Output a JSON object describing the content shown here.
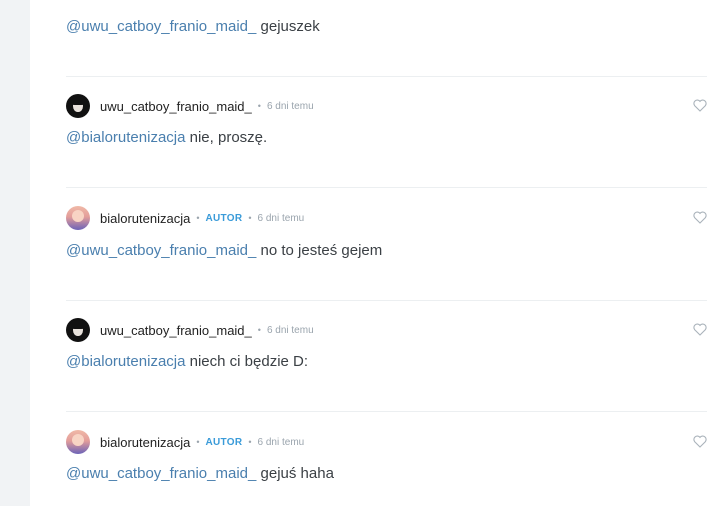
{
  "comments": [
    {
      "mention": "@uwu_catboy_franio_maid_",
      "text": " gejuszek"
    },
    {
      "username": "uwu_catboy_franio_maid_",
      "time": "6 dni temu",
      "mention": "@bialorutenizacja",
      "text": " nie, proszę.",
      "avatar": "dark"
    },
    {
      "username": "bialorutenizacja",
      "badge": "AUTOR",
      "time": "6 dni temu",
      "mention": "@uwu_catboy_franio_maid_",
      "text": " no to jesteś gejem",
      "avatar": "pink"
    },
    {
      "username": "uwu_catboy_franio_maid_",
      "time": "6 dni temu",
      "mention": "@bialorutenizacja",
      "text": " niech ci będzie D:",
      "avatar": "dark"
    },
    {
      "username": "bialorutenizacja",
      "badge": "AUTOR",
      "time": "6 dni temu",
      "mention": "@uwu_catboy_franio_maid_",
      "text": " gejuś haha",
      "avatar": "pink"
    }
  ],
  "colors": {
    "mention": "#4a7fae",
    "badge": "#3a9bd9",
    "meta": "#9aa4ad"
  }
}
